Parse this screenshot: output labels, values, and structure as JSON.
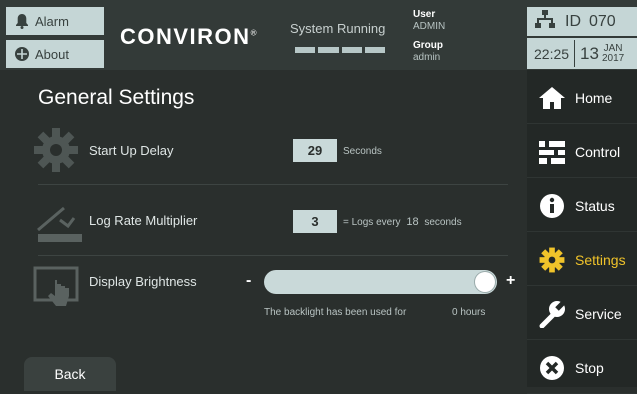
{
  "header": {
    "alarm_label": "Alarm",
    "about_label": "About",
    "logo_text": "CONVIRON",
    "logo_mark": "®",
    "system_status": "System Running",
    "user_heading": "User",
    "user_value": "ADMIN",
    "group_heading": "Group",
    "group_value": "admin",
    "id_label": "ID",
    "id_value": "070",
    "time": "22:25",
    "date_day": "13",
    "date_month": "JAN",
    "date_year": "2017"
  },
  "page": {
    "title": "General Settings"
  },
  "settings": {
    "startup": {
      "label": "Start Up Delay",
      "value": "29",
      "unit": "Seconds"
    },
    "lograte": {
      "label": "Log Rate Multiplier",
      "value": "3",
      "prefix": "= Logs every",
      "every_value": "18",
      "suffix": "seconds"
    },
    "brightness": {
      "label": "Display Brightness",
      "minus": "-",
      "plus": "+",
      "level": 1.0,
      "backlight_text": "The backlight has been used for",
      "backlight_hours": "0 hours"
    }
  },
  "nav": {
    "items": [
      {
        "label": "Home",
        "icon": "home-icon"
      },
      {
        "label": "Control",
        "icon": "control-icon"
      },
      {
        "label": "Status",
        "icon": "info-icon"
      },
      {
        "label": "Settings",
        "icon": "gear-icon"
      },
      {
        "label": "Service",
        "icon": "wrench-icon"
      },
      {
        "label": "Stop",
        "icon": "stop-icon"
      }
    ],
    "active": "Settings"
  },
  "footer": {
    "back_label": "Back"
  },
  "colors": {
    "accent": "#f0c32a",
    "panel": "#c5d6d6",
    "background": "#2a2f2d"
  }
}
